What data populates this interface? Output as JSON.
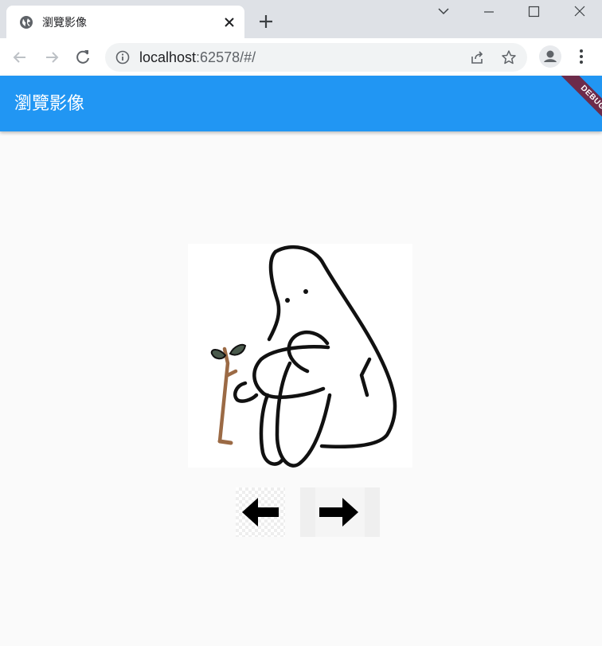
{
  "browser": {
    "tab_title": "瀏覽影像",
    "url_host": "localhost",
    "url_path": ":62578/#/"
  },
  "app": {
    "title": "瀏覽影像",
    "debug_banner": "DEBUG",
    "accent_color": "#2196f3",
    "image_icon": "person-hugging-knees-holding-sprout-illustration",
    "prev_icon": "arrow-left-icon",
    "next_icon": "arrow-right-icon"
  }
}
